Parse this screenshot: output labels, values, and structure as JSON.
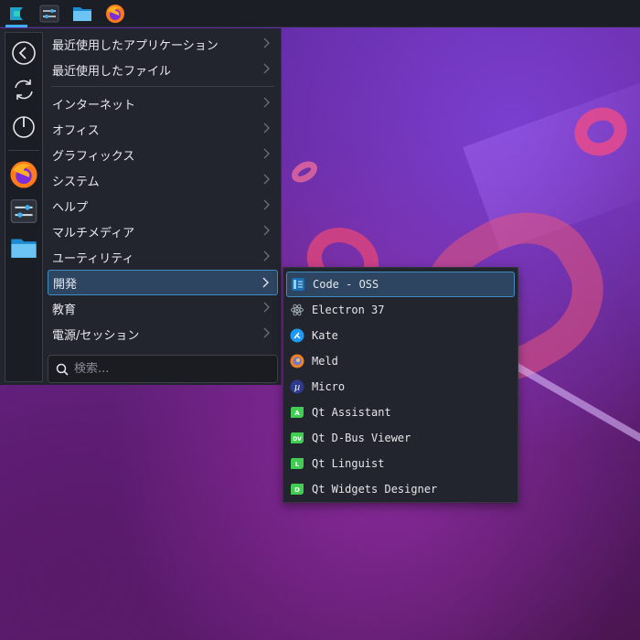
{
  "panel": {
    "buttons": [
      {
        "name": "application-launcher",
        "icon": "launcher-icon"
      },
      {
        "name": "system-settings",
        "icon": "settings-icon"
      },
      {
        "name": "file-manager",
        "icon": "folder-icon"
      },
      {
        "name": "firefox",
        "icon": "firefox-icon"
      }
    ]
  },
  "sidebar": {
    "buttons": [
      "back-icon",
      "refresh-icon",
      "power-icon"
    ],
    "favorites": [
      "firefox-icon",
      "settings-icon",
      "folder-icon"
    ]
  },
  "categories": {
    "recent": [
      {
        "label": "最近使用したアプリケーション"
      },
      {
        "label": "最近使用したファイル"
      }
    ],
    "items": [
      {
        "label": "インターネット"
      },
      {
        "label": "オフィス"
      },
      {
        "label": "グラフィックス"
      },
      {
        "label": "システム"
      },
      {
        "label": "ヘルプ"
      },
      {
        "label": "マルチメディア"
      },
      {
        "label": "ユーティリティ"
      },
      {
        "label": "開発"
      },
      {
        "label": "教育"
      },
      {
        "label": "電源/セッション"
      }
    ],
    "selected": "開発"
  },
  "search": {
    "placeholder": "検索..."
  },
  "submenu": {
    "items": [
      {
        "label": "Code - OSS",
        "icon": "vscode-icon",
        "color": "#3daee9"
      },
      {
        "label": "Electron 37",
        "icon": "electron-icon",
        "color": "#9aa6b0"
      },
      {
        "label": "Kate",
        "icon": "kate-icon",
        "color": "#1d99f3"
      },
      {
        "label": "Meld",
        "icon": "meld-icon",
        "color": "#f08020"
      },
      {
        "label": "Micro",
        "icon": "micro-icon",
        "color": "#2e3a8c"
      },
      {
        "label": "Qt Assistant",
        "icon": "qt-assistant-icon",
        "color": "#41cd52"
      },
      {
        "label": "Qt D-Bus Viewer",
        "icon": "qt-dbus-icon",
        "color": "#41cd52"
      },
      {
        "label": "Qt Linguist",
        "icon": "qt-linguist-icon",
        "color": "#41cd52"
      },
      {
        "label": "Qt Widgets Designer",
        "icon": "qt-designer-icon",
        "color": "#41cd52"
      }
    ],
    "qt_badges": [
      "A",
      "DV",
      "L",
      "D"
    ]
  },
  "colors": {
    "accent": "#3daee9",
    "selection_bg": "#2d4560",
    "menu_bg": "#23252e",
    "panel_bg": "#1c1e26"
  }
}
